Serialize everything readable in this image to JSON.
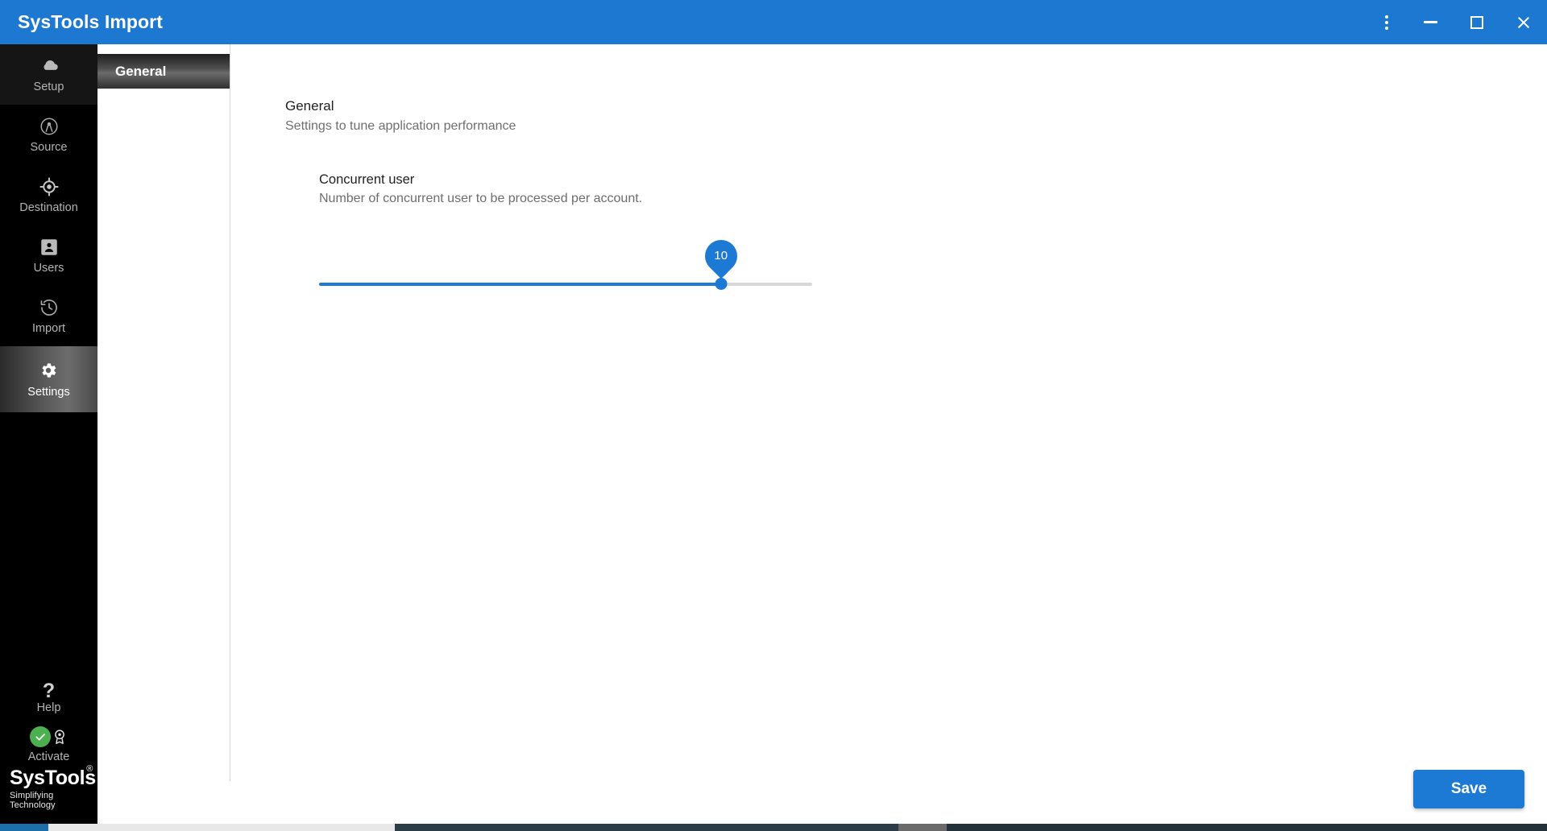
{
  "window": {
    "title": "SysTools Import",
    "titlebar_color": "#1c78d1",
    "controls": {
      "menu_label": "More options",
      "minimize_label": "Minimize",
      "maximize_label": "Maximize",
      "close_label": "Close"
    }
  },
  "sidebar": {
    "items": [
      {
        "label": "Setup",
        "icon": "cloud-icon",
        "active": false
      },
      {
        "label": "Source",
        "icon": "broadcast-icon",
        "active": false
      },
      {
        "label": "Destination",
        "icon": "target-icon",
        "active": false
      },
      {
        "label": "Users",
        "icon": "contact-card-icon",
        "active": false
      },
      {
        "label": "Import",
        "icon": "history-icon",
        "active": false
      },
      {
        "label": "Settings",
        "icon": "gear-icon",
        "active": true
      }
    ],
    "bottom_items": [
      {
        "label": "Help",
        "icon": "question-mark-icon"
      },
      {
        "label": "Activate",
        "icon": "award-badge-icon",
        "status_icon": "green-check-icon"
      }
    ],
    "logo": {
      "name": "SysTools",
      "registered": "®",
      "tagline": "Simplifying Technology"
    }
  },
  "tabs": [
    {
      "label": "General",
      "active": true
    }
  ],
  "content": {
    "heading": "General",
    "subheading": "Settings to tune application performance",
    "settings": [
      {
        "label": "Concurrent user",
        "description": "Number of concurrent user to be processed per account.",
        "control": "slider",
        "value": "10",
        "min": 1,
        "max": 10,
        "fill_percent": 81.5
      }
    ]
  },
  "footer": {
    "save_label": "Save"
  },
  "colors": {
    "accent": "#1c7ad4",
    "titlebar": "#1c78d1",
    "sidebar_bg": "#000000",
    "success": "#4caf50"
  }
}
